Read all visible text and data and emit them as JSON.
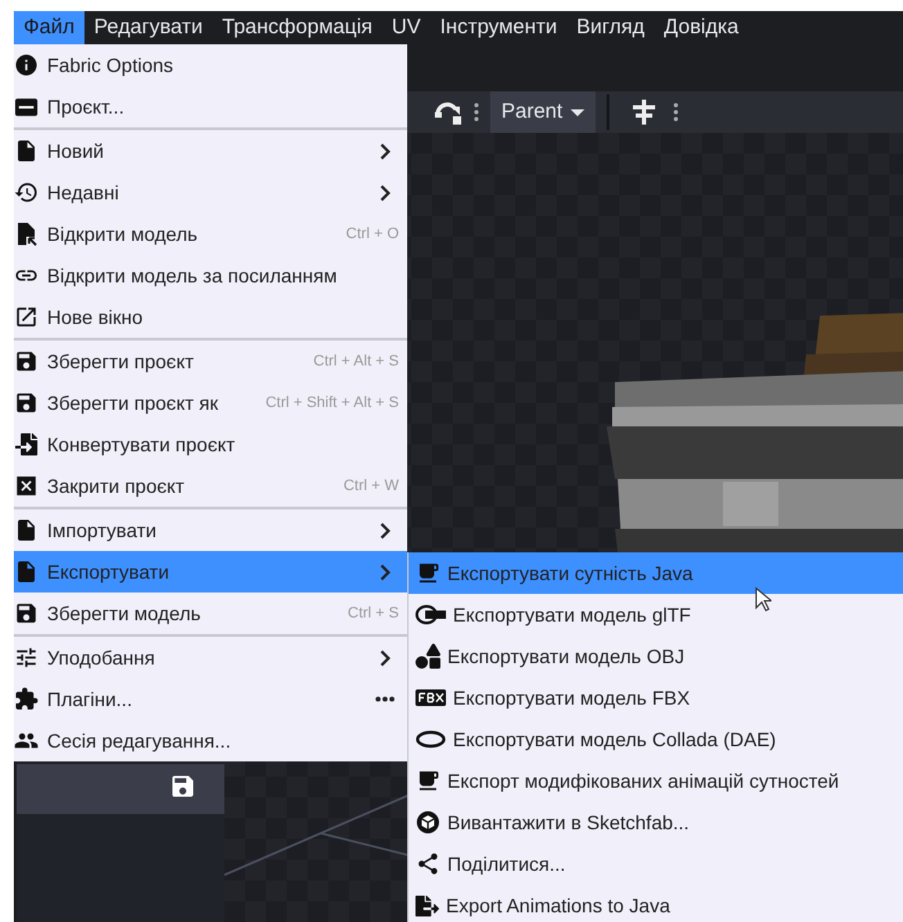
{
  "menubar": [
    {
      "label": "Файл",
      "selected": true
    },
    {
      "label": "Редагувати",
      "selected": false
    },
    {
      "label": "Трансформація",
      "selected": false
    },
    {
      "label": "UV",
      "selected": false
    },
    {
      "label": "Інструменти",
      "selected": false
    },
    {
      "label": "Вигляд",
      "selected": false
    },
    {
      "label": "Довідка",
      "selected": false
    }
  ],
  "toolbar": {
    "dropdown": "Parent"
  },
  "file_menu": {
    "groups": [
      [
        {
          "label": "Fabric Options",
          "selected": false
        },
        {
          "label": "Проєкт...",
          "selected": false
        }
      ],
      [
        {
          "label": "Новий",
          "has_submenu": true,
          "selected": false
        },
        {
          "label": "Недавні",
          "has_submenu": true,
          "selected": false
        },
        {
          "label": "Відкрити модель",
          "shortcut": "Ctrl + O",
          "selected": false
        },
        {
          "label": "Відкрити модель за посиланням",
          "selected": false
        },
        {
          "label": "Нове вікно",
          "selected": false
        }
      ],
      [
        {
          "label": "Зберегти проєкт",
          "shortcut": "Ctrl + Alt + S",
          "selected": false
        },
        {
          "label": "Зберегти проєкт як",
          "shortcut": "Ctrl + Shift + Alt + S",
          "selected": false
        },
        {
          "label": "Конвертувати проєкт",
          "selected": false
        },
        {
          "label": "Закрити проєкт",
          "shortcut": "Ctrl + W",
          "selected": false
        }
      ],
      [
        {
          "label": "Імпортувати",
          "has_submenu": true,
          "selected": false
        },
        {
          "label": "Експортувати",
          "has_submenu": true,
          "selected": true
        },
        {
          "label": "Зберегти модель",
          "shortcut": "Ctrl + S",
          "selected": false
        }
      ],
      [
        {
          "label": "Уподобання",
          "has_submenu": true,
          "selected": false
        },
        {
          "label": "Плагіни...",
          "has_more": true,
          "selected": false
        },
        {
          "label": "Сесія редагування...",
          "selected": false
        }
      ]
    ]
  },
  "export_submenu": {
    "items": [
      {
        "label": "Експортувати сутність Java",
        "selected": true
      },
      {
        "label": "Експортувати модель glTF",
        "selected": false
      },
      {
        "label": "Експортувати модель OBJ",
        "selected": false
      },
      {
        "label": "Експортувати модель FBX",
        "selected": false
      },
      {
        "label": "Експортувати модель Collada (DAE)",
        "selected": false
      },
      {
        "label": "Експорт модифікованих анімацій сутностей",
        "selected": false
      },
      {
        "label": "Вивантажити в Sketchfab...",
        "selected": false
      },
      {
        "label": "Поділитися...",
        "selected": false
      },
      {
        "label": "Export Animations to Java",
        "selected": false
      }
    ]
  }
}
